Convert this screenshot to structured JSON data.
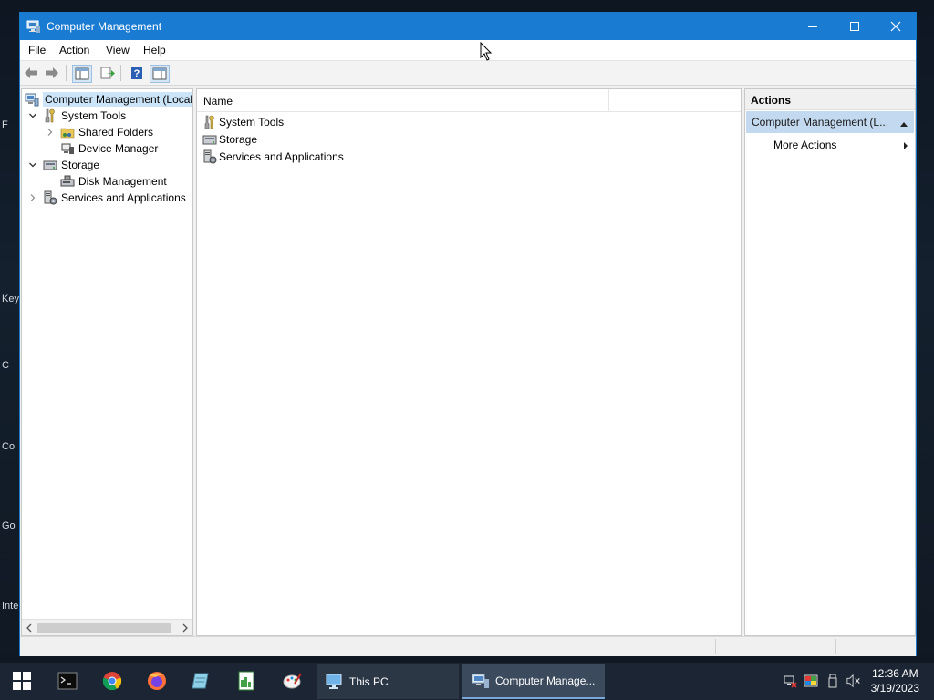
{
  "desktop": {
    "fragments": [
      "F",
      "Key",
      "C",
      "Co",
      "Go",
      "Inte"
    ]
  },
  "window": {
    "title": "Computer Management",
    "controls": {
      "minimize": "minimize",
      "maximize": "maximize",
      "close": "close"
    }
  },
  "menu": {
    "items": [
      "File",
      "Action",
      "View",
      "Help"
    ]
  },
  "tree": {
    "items": [
      {
        "label": "Computer Management (Local",
        "level": 0,
        "expander": "",
        "icon": "computer-management-icon",
        "selected": true
      },
      {
        "label": "System Tools",
        "level": 1,
        "expander": "expanded",
        "icon": "system-tools-icon"
      },
      {
        "label": "Shared Folders",
        "level": 2,
        "expander": "collapsed",
        "icon": "shared-folders-icon"
      },
      {
        "label": "Device Manager",
        "level": 2,
        "expander": "",
        "icon": "device-manager-icon"
      },
      {
        "label": "Storage",
        "level": 1,
        "expander": "expanded",
        "icon": "storage-icon"
      },
      {
        "label": "Disk Management",
        "level": 2,
        "expander": "",
        "icon": "disk-management-icon"
      },
      {
        "label": "Services and Applications",
        "level": 1,
        "expander": "collapsed",
        "icon": "services-icon"
      }
    ]
  },
  "list": {
    "columns": [
      "Name"
    ],
    "rows": [
      "System Tools",
      "Storage",
      "Services and Applications"
    ]
  },
  "actions": {
    "title": "Actions",
    "section": "Computer Management (L...",
    "items": [
      "More Actions"
    ]
  },
  "taskbar": {
    "tasks": [
      "This PC",
      "Computer Manage..."
    ],
    "time": "12:36 AM",
    "date": "3/19/2023"
  },
  "colors": {
    "titlebar": "#1a7bd2",
    "selection": "#cce4f7",
    "actions_section": "#c3d9ef",
    "taskbar": "#1b2533"
  }
}
